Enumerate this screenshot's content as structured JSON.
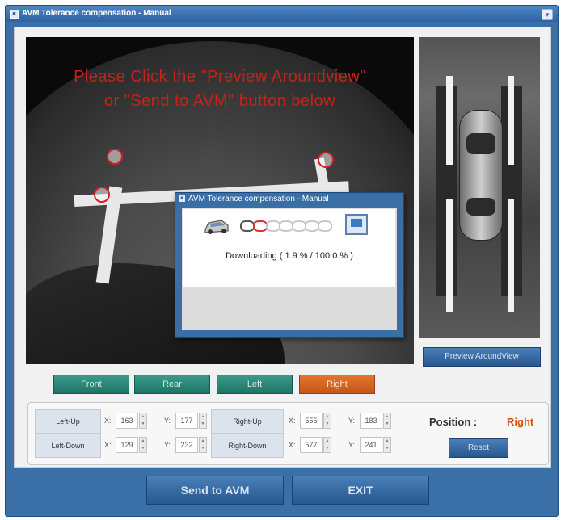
{
  "window": {
    "title": "AVM Tolerance compensation - Manual"
  },
  "camera": {
    "message_line1": "Please Click the \"Preview Aroundview\"",
    "message_line2": "or \"Send to AVM\" button below"
  },
  "topview": {
    "preview_button": "Preview AroundView"
  },
  "camera_buttons": [
    {
      "label": "Front",
      "active": false
    },
    {
      "label": "Rear",
      "active": false
    },
    {
      "label": "Left",
      "active": false
    },
    {
      "label": "Right",
      "active": true
    }
  ],
  "dialog": {
    "title": "AVM Tolerance compensation - Manual",
    "status": "Downloading ( 1.9 % / 100.0 % )",
    "progress_percent": 1.9
  },
  "points": {
    "left_up": {
      "label": "Left-Up",
      "x": "163",
      "y": "177"
    },
    "left_down": {
      "label": "Left-Down",
      "x": "129",
      "y": "232"
    },
    "right_up": {
      "label": "Right-Up",
      "x": "555",
      "y": "183"
    },
    "right_down": {
      "label": "Right-Down",
      "x": "577",
      "y": "241"
    },
    "x_label": "X:",
    "y_label": "Y:"
  },
  "position": {
    "label": "Position :",
    "value": "Right",
    "reset_button": "Reset"
  },
  "footer": {
    "send_button": "Send to AVM",
    "exit_button": "EXIT"
  },
  "colors": {
    "accent_blue": "#3b6fa8",
    "active_orange": "#d2531a",
    "inactive_teal": "#2a8576",
    "message_red": "#c8201a"
  }
}
